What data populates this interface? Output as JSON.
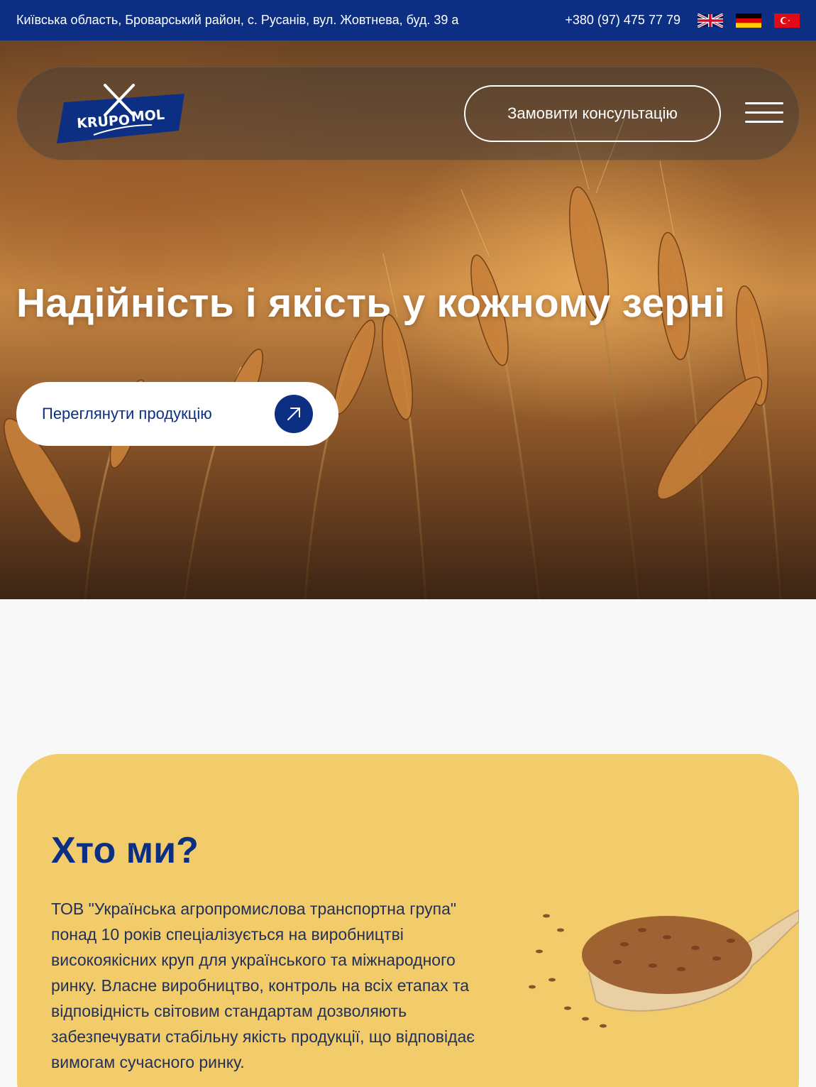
{
  "topbar": {
    "address": "Київська область, Броварський район, с. Русанів, вул. Жовтнева, буд. 39 а",
    "phone": "+380 (97) 475 77 79",
    "languages": [
      "en-flag-icon",
      "de-flag-icon",
      "tr-flag-icon"
    ]
  },
  "header": {
    "logo_text": "KRUPOMOL",
    "consult_label": "Замовити консультацію",
    "menu_icon": "burger-menu-icon"
  },
  "hero": {
    "title": "Надійність і якість у кожному зерні",
    "cta_label": "Переглянути продукцію",
    "cta_icon": "arrow-up-right-icon"
  },
  "about": {
    "title": "Хто ми?",
    "text": "ТОВ \"Українська агропромислова транспортна група\" понад 10 років спеціалізується на виробництві високоякісних круп для українського та міжнародного ринку. Власне виробництво, контроль на всіх етапах та відповідність світовим стандартам дозволяють забезпечувати стабільну якість продукції, що відповідає вимогам сучасного ринку."
  },
  "colors": {
    "brand_blue": "#0c2f83",
    "about_bg": "#f2cb6b",
    "page_bg": "#f8f8f8"
  }
}
